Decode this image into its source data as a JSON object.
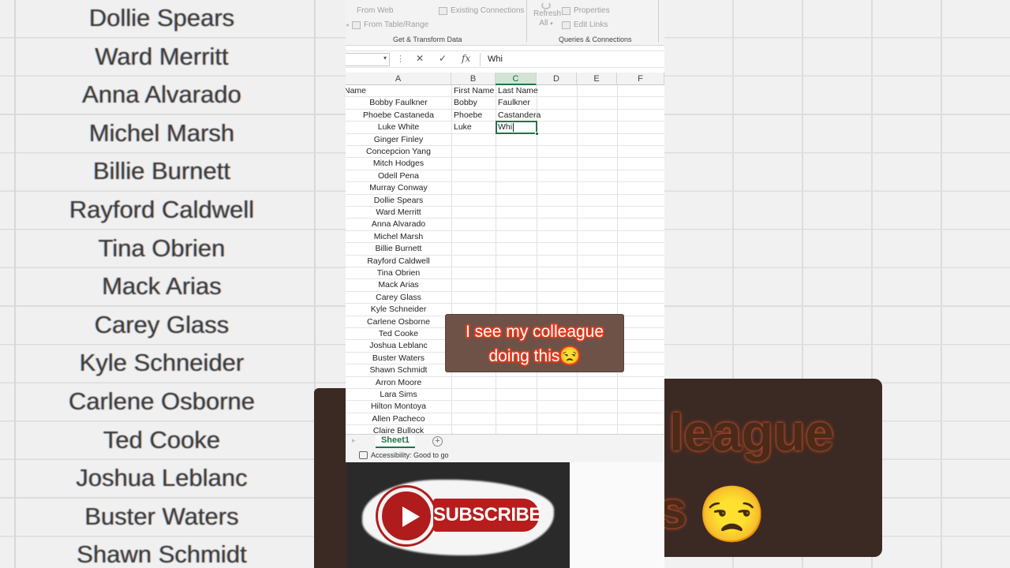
{
  "background": {
    "left_names": [
      "Dollie Spears",
      "Ward Merritt",
      "Anna Alvarado",
      "Michel Marsh",
      "Billie Burnett",
      "Rayford Caldwell",
      "Tina Obrien",
      "Mack Arias",
      "Carey Glass",
      "Kyle Schneider",
      "Carlene Osborne",
      "Ted Cooke",
      "Joshua Leblanc",
      "Buster Waters",
      "Shawn Schmidt"
    ],
    "right_caption_line1": "league",
    "right_caption_line2": "s",
    "right_emoji": "😒"
  },
  "ribbon": {
    "from_web": "From Web",
    "existing_connections": "Existing Connections",
    "from_table_range": "From Table/Range",
    "refresh_label": "Refresh",
    "refresh_all": "All",
    "properties": "Properties",
    "edit_links": "Edit Links",
    "group_get_transform": "Get & Transform Data",
    "group_queries": "Queries & Connections"
  },
  "formula_bar": {
    "name_box": "",
    "cancel_glyph": "✕",
    "enter_glyph": "✓",
    "fx_label": "fx",
    "value": "Whi"
  },
  "grid": {
    "columns": [
      "A",
      "B",
      "C",
      "D",
      "E",
      "F"
    ],
    "selected_column": "C",
    "rows": [
      {
        "a": "Name",
        "b": "First Name",
        "c": "Last Name"
      },
      {
        "a": "Bobby Faulkner",
        "b": "Bobby",
        "c": "Faulkner"
      },
      {
        "a": "Phoebe Castaneda",
        "b": "Phoebe",
        "c": "Castandera"
      },
      {
        "a": "Luke White",
        "b": "Luke",
        "c": "Whi"
      },
      {
        "a": "Ginger Finley",
        "b": "",
        "c": ""
      },
      {
        "a": "Concepcion Yang",
        "b": "",
        "c": ""
      },
      {
        "a": "Mitch Hodges",
        "b": "",
        "c": ""
      },
      {
        "a": "Odell Pena",
        "b": "",
        "c": ""
      },
      {
        "a": "Murray Conway",
        "b": "",
        "c": ""
      },
      {
        "a": "Dollie Spears",
        "b": "",
        "c": ""
      },
      {
        "a": "Ward Merritt",
        "b": "",
        "c": ""
      },
      {
        "a": "Anna Alvarado",
        "b": "",
        "c": ""
      },
      {
        "a": "Michel Marsh",
        "b": "",
        "c": ""
      },
      {
        "a": "Billie Burnett",
        "b": "",
        "c": ""
      },
      {
        "a": "Rayford Caldwell",
        "b": "",
        "c": ""
      },
      {
        "a": "Tina Obrien",
        "b": "",
        "c": ""
      },
      {
        "a": "Mack Arias",
        "b": "",
        "c": ""
      },
      {
        "a": "Carey Glass",
        "b": "",
        "c": ""
      },
      {
        "a": "Kyle Schneider",
        "b": "",
        "c": ""
      },
      {
        "a": "Carlene Osborne",
        "b": "",
        "c": ""
      },
      {
        "a": "Ted Cooke",
        "b": "",
        "c": ""
      },
      {
        "a": "Joshua Leblanc",
        "b": "",
        "c": ""
      },
      {
        "a": "Buster Waters",
        "b": "",
        "c": ""
      },
      {
        "a": "Shawn Schmidt",
        "b": "",
        "c": ""
      },
      {
        "a": "Arron Moore",
        "b": "",
        "c": ""
      },
      {
        "a": "Lara Sims",
        "b": "",
        "c": ""
      },
      {
        "a": "Hilton Montoya",
        "b": "",
        "c": ""
      },
      {
        "a": "Allen Pacheco",
        "b": "",
        "c": ""
      },
      {
        "a": "Claire Bullock",
        "b": "",
        "c": ""
      }
    ]
  },
  "sheets": {
    "active": "Sheet1",
    "add_glyph": "+"
  },
  "status": {
    "accessibility": "Accessibility: Good to go"
  },
  "overlay": {
    "caption_line1": "I see my colleague",
    "caption_line2": "doing this😒",
    "subscribe_label": "SUBSCRIBE"
  },
  "colors": {
    "excel_green": "#217346",
    "subscribe_red": "#b81d1d",
    "caption_outline": "#e03a1e"
  }
}
